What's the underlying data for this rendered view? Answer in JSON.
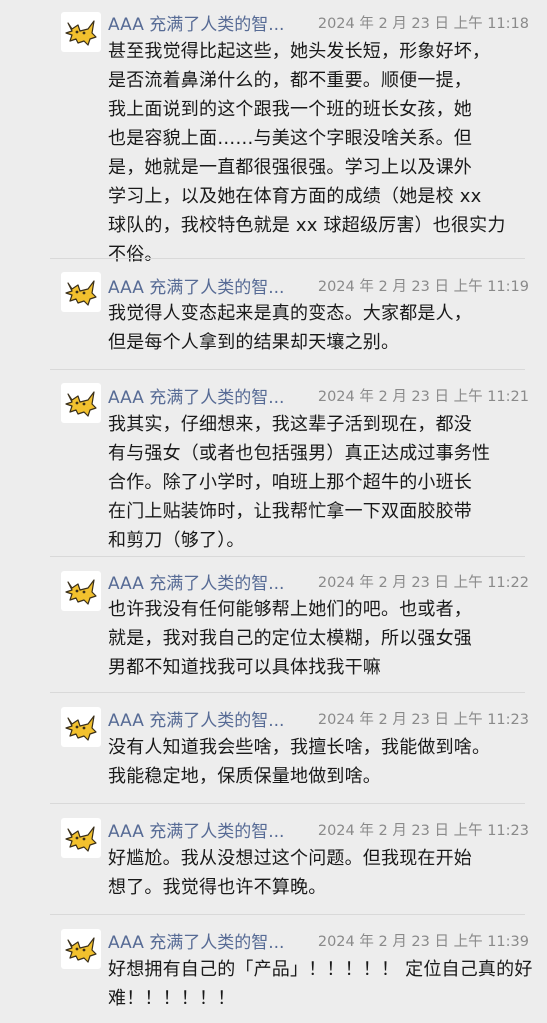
{
  "messages": [
    {
      "sender": "AAA 充满了人类的智...",
      "time": "2024 年 2 月 23 日 上午 11:18",
      "text": "甚至我觉得比起这些，她头发长短，形象好坏，\n是否流着鼻涕什么的，都不重要。顺便一提，\n我上面说到的这个跟我一个班的班长女孩，她\n也是容貌上面……与美这个字眼没啥关系。但\n是，她就是一直都很强很强。学习上以及课外\n学习上，以及她在体育方面的成绩（她是校 xx\n球队的，我校特色就是 xx 球超级厉害）也很实力\n不俗。"
    },
    {
      "sender": "AAA 充满了人类的智...",
      "time": "2024 年 2 月 23 日 上午 11:19",
      "text": "我觉得人变态起来是真的变态。大家都是人，\n但是每个人拿到的结果却天壤之别。"
    },
    {
      "sender": "AAA 充满了人类的智...",
      "time": "2024 年 2 月 23 日 上午 11:21",
      "text": "我其实，仔细想来，我这辈子活到现在，都没\n有与强女（或者也包括强男）真正达成过事务性\n合作。除了小学时，咱班上那个超牛的小班长\n在门上贴装饰时，让我帮忙拿一下双面胶胶带\n和剪刀（够了）。"
    },
    {
      "sender": "AAA 充满了人类的智...",
      "time": "2024 年 2 月 23 日 上午 11:22",
      "text": "也许我没有任何能够帮上她们的吧。也或者，\n就是，我对我自己的定位太模糊，所以强女强\n男都不知道找我可以具体找我干嘛"
    },
    {
      "sender": "AAA 充满了人类的智...",
      "time": "2024 年 2 月 23 日 上午 11:23",
      "text": "没有人知道我会些啥，我擅长啥，我能做到啥。\n我能稳定地，保质保量地做到啥。"
    },
    {
      "sender": "AAA 充满了人类的智...",
      "time": "2024 年 2 月 23 日 上午 11:23",
      "text": "好尴尬。我从没想过这个问题。但我现在开始\n想了。我觉得也许不算晚。"
    },
    {
      "sender": "AAA 充满了人类的智...",
      "time": "2024 年 2 月 23 日 上午 11:39",
      "text": "好想拥有自己的「产品」！！！！！ 定位自己真的好\n难！！！！！！"
    }
  ],
  "theme": {
    "sender_color": "#576b95",
    "time_color": "#8a8a8a",
    "text_color": "#191919",
    "background": "#ededed",
    "avatar_icon": "yellow-cat-icon"
  }
}
